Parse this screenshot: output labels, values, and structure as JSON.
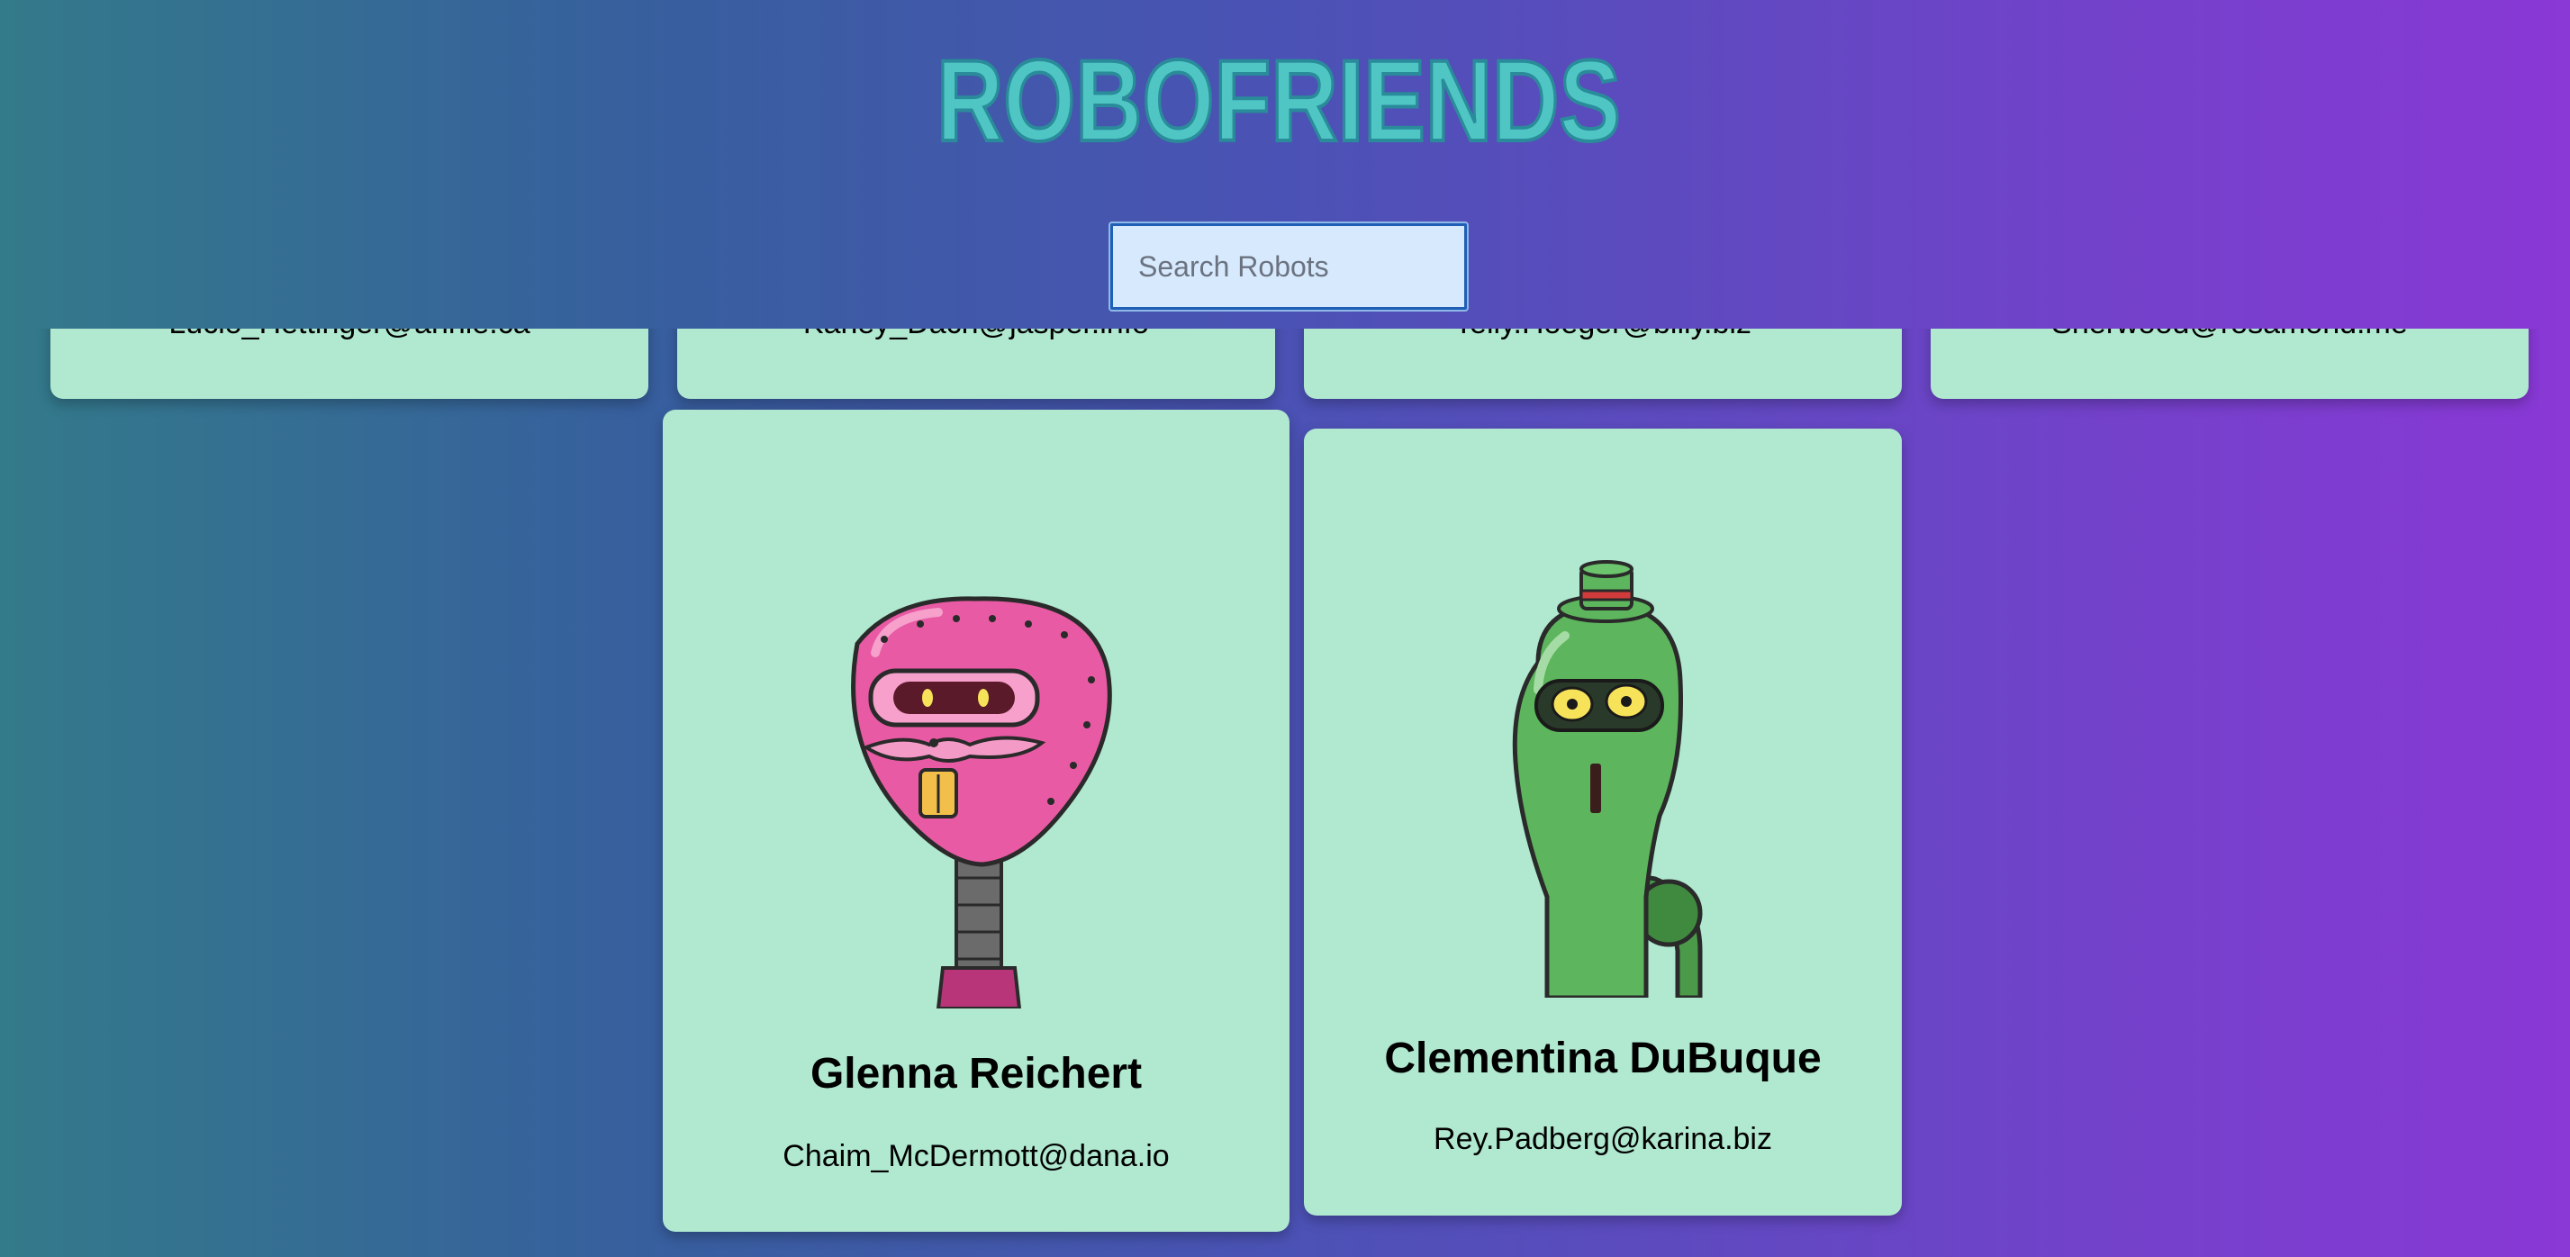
{
  "app": {
    "title": "ROBOFRIENDS"
  },
  "search": {
    "placeholder": "Search Robots",
    "value": ""
  },
  "cards_row1": [
    {
      "email": "Lucio_Hettinger@annie.ca"
    },
    {
      "email": "Karley_Dach@jasper.info"
    },
    {
      "email": "Telly.Hoeger@billy.biz"
    },
    {
      "email": "Sherwood@rosamond.me"
    }
  ],
  "cards_row2": [
    {
      "name": "Glenna Reichert",
      "email": "Chaim_McDermott@dana.io",
      "avatar": "pink-robot-avatar"
    },
    {
      "name": "Clementina DuBuque",
      "email": "Rey.Padberg@karina.biz",
      "avatar": "green-robot-avatar"
    }
  ],
  "colors": {
    "card": "#b0e8d0",
    "title": "#4fc6c4",
    "title_outline": "#2a8b9a",
    "search_bg": "#d7eafd",
    "search_border": "#1f5fb5"
  }
}
